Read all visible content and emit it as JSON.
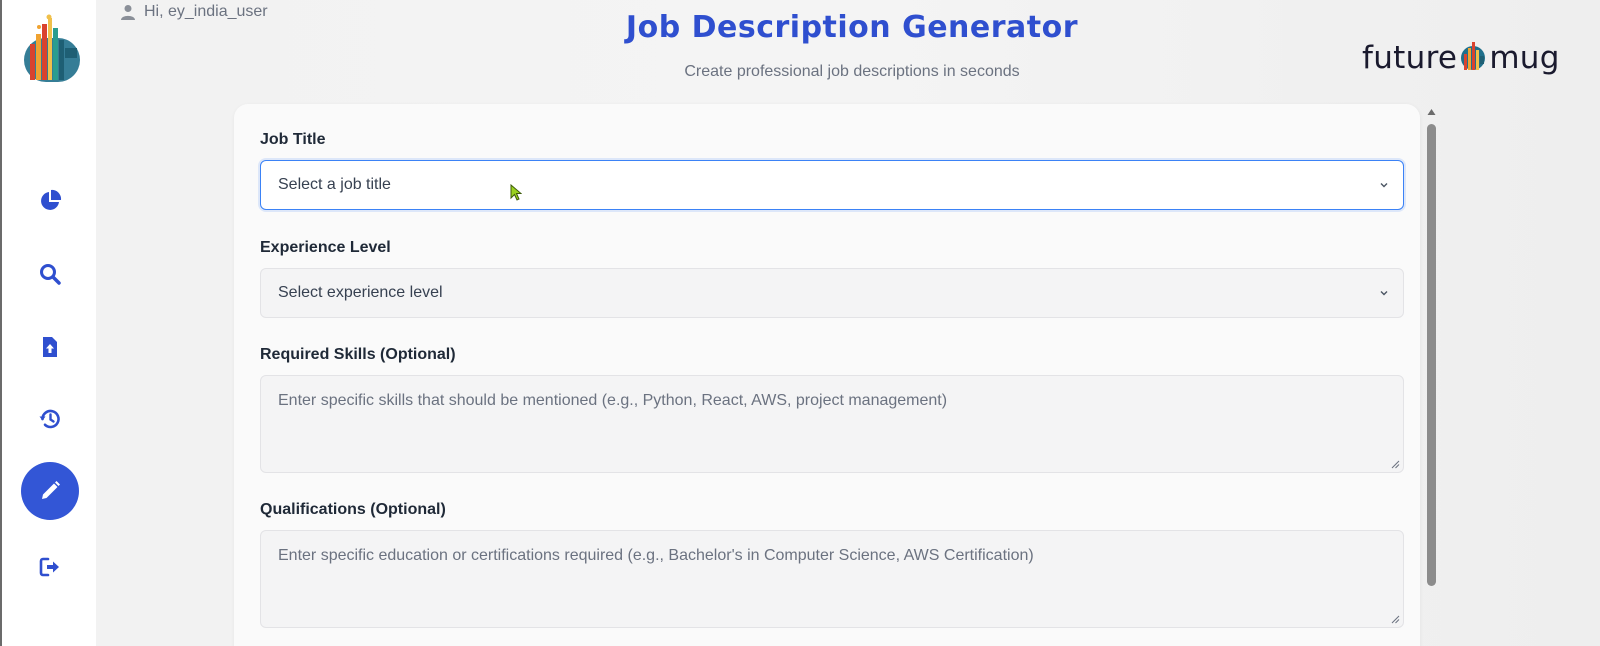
{
  "app": {
    "logo": "bar-chart-logo-icon"
  },
  "sidebar": {
    "items": [
      {
        "icon": "pie-chart-icon",
        "label": "Dashboard"
      },
      {
        "icon": "search-icon",
        "label": "Search"
      },
      {
        "icon": "file-upload-icon",
        "label": "Upload"
      },
      {
        "icon": "history-icon",
        "label": "History"
      },
      {
        "icon": "pencil-icon",
        "label": "Job Description Generator",
        "active": true
      },
      {
        "icon": "logout-icon",
        "label": "Logout"
      }
    ]
  },
  "header": {
    "greeting": "Hi, ey_india_user",
    "title": "Job Description Generator",
    "subtitle": "Create professional job descriptions in seconds",
    "brand_left": "future",
    "brand_right": "mug"
  },
  "form": {
    "job_title": {
      "label": "Job Title",
      "placeholder": "Select a job title"
    },
    "experience": {
      "label": "Experience Level",
      "placeholder": "Select experience level"
    },
    "skills": {
      "label": "Required Skills (Optional)",
      "placeholder": "Enter specific skills that should be mentioned (e.g., Python, React, AWS, project management)"
    },
    "qualifications": {
      "label": "Qualifications (Optional)",
      "placeholder": "Enter specific education or certifications required (e.g., Bachelor's in Computer Science, AWS Certification)"
    }
  },
  "colors": {
    "accent": "#2f4fcf",
    "active_nav": "#3356d6",
    "focus_border": "#3b82f6"
  }
}
